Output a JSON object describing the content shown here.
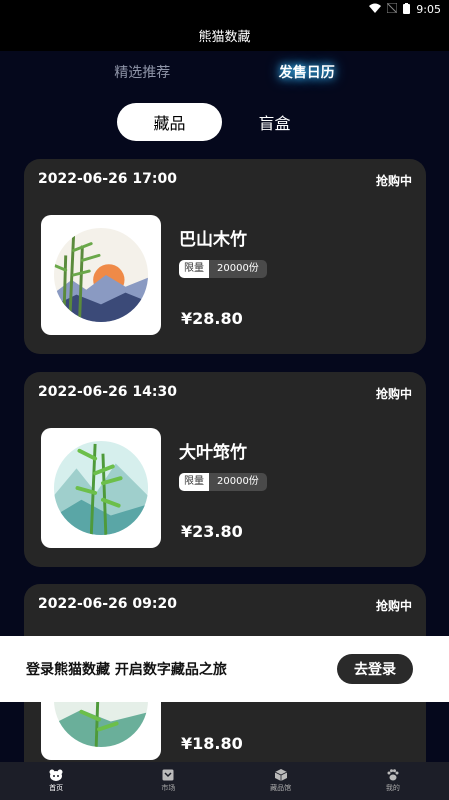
{
  "status_bar": {
    "time": "9:05"
  },
  "header": {
    "title": "熊猫数藏"
  },
  "top_tabs": [
    {
      "label": "精选推荐"
    },
    {
      "label": "发售日历"
    }
  ],
  "segments": [
    {
      "label": "藏品"
    },
    {
      "label": "盲盒"
    }
  ],
  "cards": [
    {
      "date": "2022-06-26 17:00",
      "status": "抢购中",
      "name": "巴山木竹",
      "tag_label": "限量",
      "tag_count": "20000份",
      "price": "¥28.80"
    },
    {
      "date": "2022-06-26 14:30",
      "status": "抢购中",
      "name": "大叶筇竹",
      "tag_label": "限量",
      "tag_count": "20000份",
      "price": "¥23.80"
    },
    {
      "date": "2022-06-26 09:20",
      "status": "抢购中",
      "price": "¥18.80"
    }
  ],
  "login_banner": {
    "text": "登录熊猫数藏 开启数字藏品之旅",
    "button": "去登录"
  },
  "tabbar": [
    {
      "label": "首页"
    },
    {
      "label": "市场"
    },
    {
      "label": "藏品馆"
    },
    {
      "label": "我的"
    }
  ]
}
